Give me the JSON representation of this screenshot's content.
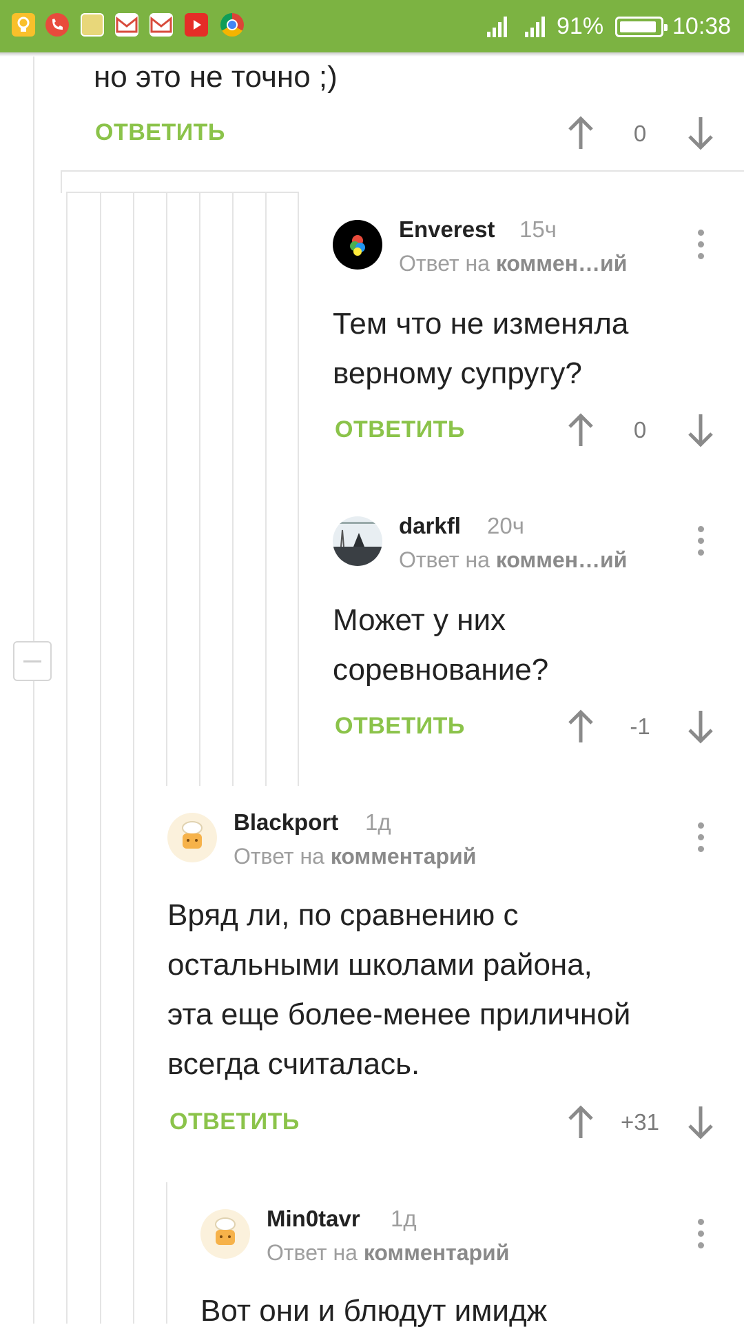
{
  "status_bar": {
    "battery": "91%",
    "time": "10:38",
    "notification_icons": [
      "lightbulb-icon",
      "missed-call-icon",
      "app-icon",
      "gmail-icon",
      "gmail-icon",
      "youtube-icon",
      "chrome-icon"
    ]
  },
  "comments": [
    {
      "text": "но это не точно ;)",
      "reply_label": "ОТВЕТИТЬ",
      "score": "0"
    },
    {
      "author": "Enverest",
      "time": "15ч",
      "reply_to_prefix": "Ответ на",
      "reply_to_target": "коммен…ий",
      "text_lines": [
        "Тем что не изменяла",
        "верному супругу?"
      ],
      "reply_label": "ОТВЕТИТЬ",
      "score": "0"
    },
    {
      "author": "darkfl",
      "time": "20ч",
      "reply_to_prefix": "Ответ на",
      "reply_to_target": "коммен…ий",
      "text_lines": [
        "Может у них",
        "соревнование?"
      ],
      "reply_label": "ОТВЕТИТЬ",
      "score": "-1"
    },
    {
      "author": "Blackport",
      "time": "1д",
      "reply_to_prefix": "Ответ на",
      "reply_to_target": "комментарий",
      "text_lines": [
        "Вряд ли, по сравнению с",
        "остальными школами района,",
        "эта еще более-менее приличной",
        "всегда считалась."
      ],
      "reply_label": "ОТВЕТИТЬ",
      "score": "+31"
    },
    {
      "author": "Min0tavr",
      "time": "1д",
      "reply_to_prefix": "Ответ на",
      "reply_to_target": "комментарий",
      "text_lines": [
        "Вот они и блюдут имидж"
      ]
    }
  ],
  "colors": {
    "accent": "#8bc34a",
    "status_bar": "#7cb342"
  }
}
